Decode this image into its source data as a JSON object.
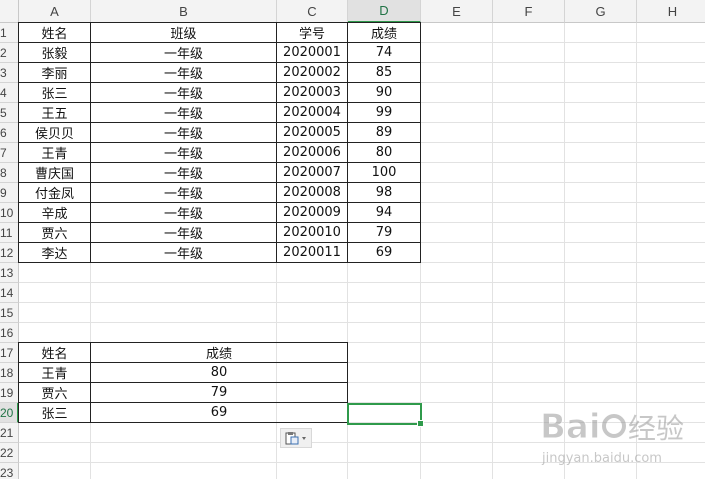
{
  "columns": [
    "A",
    "B",
    "C",
    "D",
    "E",
    "F",
    "G",
    "H"
  ],
  "active_column": "D",
  "rows": [
    "1",
    "2",
    "3",
    "4",
    "5",
    "6",
    "7",
    "8",
    "9",
    "10",
    "11",
    "12",
    "13",
    "14",
    "15",
    "16",
    "17",
    "18",
    "19",
    "20",
    "21",
    "22",
    "23"
  ],
  "active_row": "20",
  "table1": {
    "headers": [
      "姓名",
      "班级",
      "学号",
      "成绩"
    ],
    "rows": [
      [
        "张毅",
        "一年级",
        "2020001",
        "74"
      ],
      [
        "李丽",
        "一年级",
        "2020002",
        "85"
      ],
      [
        "张三",
        "一年级",
        "2020003",
        "90"
      ],
      [
        "王五",
        "一年级",
        "2020004",
        "99"
      ],
      [
        "侯贝贝",
        "一年级",
        "2020005",
        "89"
      ],
      [
        "王青",
        "一年级",
        "2020006",
        "80"
      ],
      [
        "曹庆国",
        "一年级",
        "2020007",
        "100"
      ],
      [
        "付金凤",
        "一年级",
        "2020008",
        "98"
      ],
      [
        "辛成",
        "一年级",
        "2020009",
        "94"
      ],
      [
        "贾六",
        "一年级",
        "2020010",
        "79"
      ],
      [
        "李达",
        "一年级",
        "2020011",
        "69"
      ]
    ]
  },
  "table2": {
    "headers": [
      "姓名",
      "成绩"
    ],
    "rows": [
      [
        "王青",
        "80"
      ],
      [
        "贾六",
        "79"
      ],
      [
        "张三",
        "69"
      ]
    ]
  },
  "watermark": {
    "text": "Bai经验",
    "url": "jingyan.baidu.com"
  },
  "icons": {
    "paste_options": "paste-options-icon"
  }
}
